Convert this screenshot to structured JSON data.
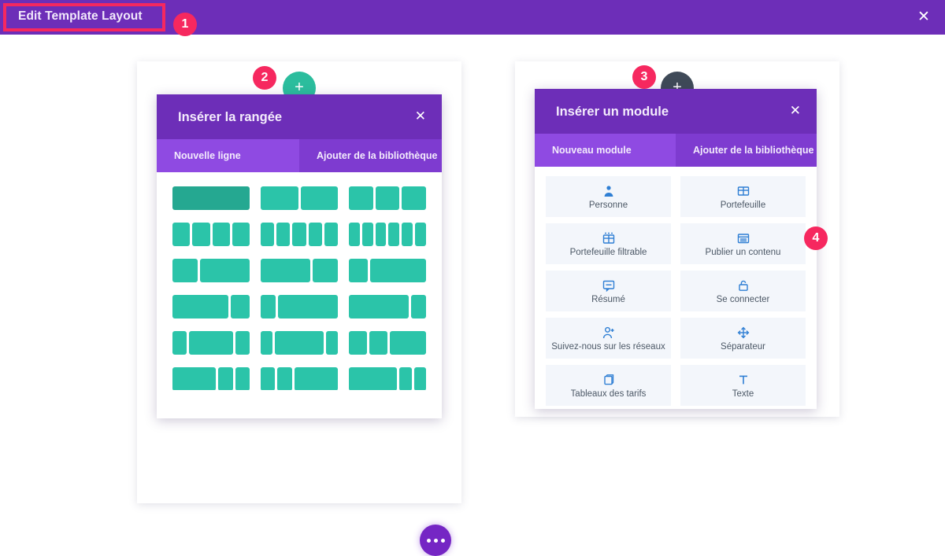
{
  "topbar": {
    "title": "Edit Template Layout",
    "close_icon": "close-icon",
    "bg": "#6d2eb8"
  },
  "annotations": {
    "badges": [
      "1",
      "2",
      "3",
      "4"
    ]
  },
  "left_canvas": {
    "add_row_button": {
      "icon": "plus-icon",
      "color": "#2bbd9d"
    },
    "more_button": {
      "icon": "ellipsis-icon",
      "color": "#7526c4"
    },
    "dialog": {
      "title": "Insérer la rangée",
      "close_icon": "close-icon",
      "tabs": [
        {
          "label": "Nouvelle ligne",
          "active": true
        },
        {
          "label": "Ajouter de la bibliothèque",
          "active": false
        }
      ],
      "layouts": [
        {
          "cols": [
            1
          ],
          "selected": true
        },
        {
          "cols": [
            1,
            1
          ],
          "selected": false
        },
        {
          "cols": [
            1,
            1,
            1
          ],
          "selected": false
        },
        {
          "cols": [
            1,
            1,
            1,
            1
          ],
          "selected": false
        },
        {
          "cols": [
            1,
            1,
            1,
            1,
            1
          ],
          "selected": false
        },
        {
          "cols": [
            1,
            1,
            1,
            1,
            1,
            1
          ],
          "selected": false
        },
        {
          "cols": [
            1,
            2
          ],
          "selected": false
        },
        {
          "cols": [
            2,
            1
          ],
          "selected": false
        },
        {
          "cols": [
            1,
            3
          ],
          "selected": false
        },
        {
          "cols": [
            3,
            1
          ],
          "selected": false
        },
        {
          "cols": [
            1,
            4
          ],
          "selected": false
        },
        {
          "cols": [
            4,
            1
          ],
          "selected": false
        },
        {
          "cols": [
            1,
            3,
            1
          ],
          "selected": false
        },
        {
          "cols": [
            1,
            4,
            1
          ],
          "selected": false
        },
        {
          "cols": [
            1,
            1,
            2
          ],
          "selected": false
        },
        {
          "cols": [
            3,
            1,
            1
          ],
          "selected": false
        },
        {
          "cols": [
            1,
            1,
            3
          ],
          "selected": false
        },
        {
          "cols": [
            4,
            1,
            1
          ],
          "selected": false
        }
      ],
      "block_color": "#2bc4a9",
      "block_color_selected": "#25a891"
    }
  },
  "right_canvas": {
    "add_module_button": {
      "icon": "plus-icon",
      "color": "#3f4a58"
    },
    "dialog": {
      "title": "Insérer un module",
      "close_icon": "close-icon",
      "tabs": [
        {
          "label": "Nouveau module",
          "active": true
        },
        {
          "label": "Ajouter de la bibliothèque",
          "active": false
        }
      ],
      "modules": [
        {
          "label": "Personne",
          "icon": "person-icon",
          "highlighted": false
        },
        {
          "label": "Portefeuille",
          "icon": "grid-icon",
          "highlighted": false
        },
        {
          "label": "Portefeuille filtrable",
          "icon": "filter-grid-icon",
          "highlighted": false
        },
        {
          "label": "Publier un contenu",
          "icon": "post-icon",
          "highlighted": true
        },
        {
          "label": "Résumé",
          "icon": "comment-icon",
          "highlighted": false
        },
        {
          "label": "Se connecter",
          "icon": "lock-icon",
          "highlighted": false
        },
        {
          "label": "Suivez-nous sur les réseaux",
          "icon": "person-add-icon",
          "highlighted": false
        },
        {
          "label": "Séparateur",
          "icon": "move-icon",
          "highlighted": false
        },
        {
          "label": "Tableaux des tarifs",
          "icon": "cube-icon",
          "highlighted": false
        },
        {
          "label": "Texte",
          "icon": "text-icon",
          "highlighted": false
        }
      ],
      "icon_color": "#2f7fd4"
    }
  }
}
